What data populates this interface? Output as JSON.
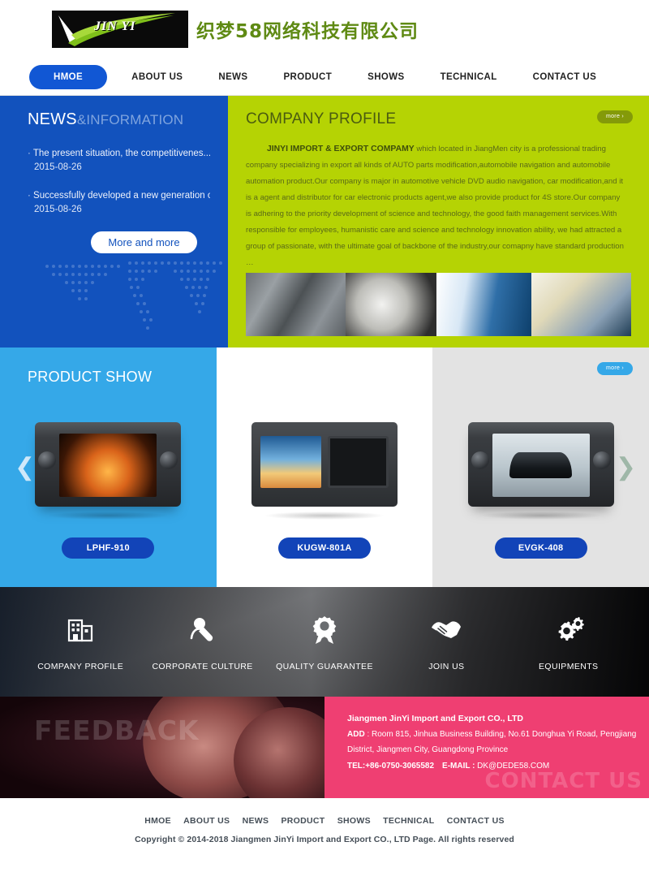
{
  "header": {
    "logo_mark_text": "JIN YI",
    "logo_company_cn": "织梦58网络科技有限公司",
    "logo_icon": "jinyi-swoosh-logo"
  },
  "nav": {
    "items": [
      {
        "label": "HMOE",
        "active": true
      },
      {
        "label": "ABOUT US",
        "active": false
      },
      {
        "label": "NEWS",
        "active": false
      },
      {
        "label": "PRODUCT",
        "active": false
      },
      {
        "label": "SHOWS",
        "active": false
      },
      {
        "label": "TECHNICAL",
        "active": false
      },
      {
        "label": "CONTACT US",
        "active": false
      }
    ]
  },
  "news": {
    "title_main": "NEWS",
    "title_sub": "&INFORMATION",
    "items": [
      {
        "title": "The present situation, the competitivenes....",
        "date": "2015-08-26"
      },
      {
        "title": "Successfully developed a new generation o....",
        "date": "2015-08-26"
      }
    ],
    "more_label": "More and more"
  },
  "profile": {
    "title": "COMPANY PROFILE",
    "more_label": "more ›",
    "lead": "JINYI IMPORT & EXPORT COMPAMY",
    "body": " which located in JiangMen city is a professional trading company specializing in export all kinds of AUTO parts modification,automobile navigation and automobile automation product.Our company is major in automotive vehicle DVD audio navigation, car modification,and it is a agent and distributor for car electronic products agent,we also provide product for 4S store.Our company is adhering to the priority development of science and technology, the good faith management services.With responsible for employees, humanistic care and science and technology innovation ability, we had attracted a group of passionate, with the ultimate goal of backbone of the industry,our comapny have standard production …"
  },
  "products": {
    "title": "PRODUCT SHOW",
    "more_label": "more ›",
    "prev_icon": "chevron-left-icon",
    "next_icon": "chevron-right-icon",
    "items": [
      {
        "name": "LPHF-910"
      },
      {
        "name": "KUGW-801A"
      },
      {
        "name": "EVGK-408"
      }
    ]
  },
  "features": {
    "items": [
      {
        "label": "COMPANY PROFILE",
        "icon": "building-icon"
      },
      {
        "label": "CORPORATE CULTURE",
        "icon": "microphone-icon"
      },
      {
        "label": "QUALITY GUARANTEE",
        "icon": "award-ribbon-icon"
      },
      {
        "label": "JOIN US",
        "icon": "handshake-icon"
      },
      {
        "label": "EQUIPMENTS",
        "icon": "gears-icon"
      }
    ]
  },
  "feedback": {
    "watermark": "FEEDBACK"
  },
  "contact": {
    "watermark": "CONTACT US",
    "company": "Jiangmen JinYi Import and Export CO., LTD",
    "add_label": "ADD",
    "address": " : Room 815, Jinhua Business Building, No.61 Donghua Yi Road, Pengjiang District, Jiangmen City, Guangdong Province",
    "tel": "TEL:+86-0750-3065582",
    "email_label": "E-MAIL :",
    "email": " DK@DEDE58.COM"
  },
  "footer": {
    "nav": [
      "HMOE",
      "ABOUT US",
      "NEWS",
      "PRODUCT",
      "SHOWS",
      "TECHNICAL",
      "CONTACT US"
    ],
    "copyright": "Copyright © 2014-2018 Jiangmen JinYi Import and Export CO., LTD   Page. All rights reserved"
  },
  "colors": {
    "nav_active": "#1157d4",
    "news_bg": "#1252bd",
    "profile_bg": "#b5d304",
    "product_blue": "#35a8e8",
    "product_gray": "#e3e3e3",
    "product_btn": "#1244b8",
    "contact_pink": "#ef3f72",
    "logo_green": "#5f8a14"
  }
}
